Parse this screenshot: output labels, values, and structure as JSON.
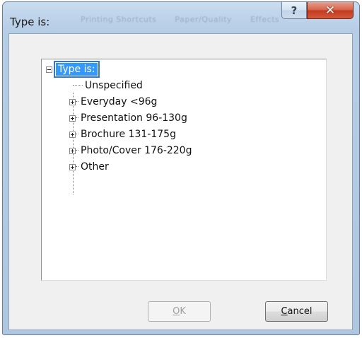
{
  "window": {
    "title": "Type is:",
    "background_tabs": [
      "Printing Shortcuts",
      "Paper/Quality",
      "Effects"
    ],
    "help_glyph": "?",
    "close_glyph": "✕"
  },
  "tree": {
    "root": {
      "label": "Type is:",
      "expanded": true,
      "selected": true
    },
    "items": [
      {
        "label": "Unspecified",
        "expandable": false
      },
      {
        "label": "Everyday <96g",
        "expandable": true
      },
      {
        "label": "Presentation 96-130g",
        "expandable": true
      },
      {
        "label": "Brochure 131-175g",
        "expandable": true
      },
      {
        "label": "Photo/Cover 176-220g",
        "expandable": true
      },
      {
        "label": "Other",
        "expandable": true
      }
    ]
  },
  "buttons": {
    "ok": {
      "label": "OK",
      "enabled": false
    },
    "cancel": {
      "label": "Cancel",
      "enabled": true
    }
  },
  "colors": {
    "selection": "#3399ff",
    "close_button": "#c23a1e",
    "frame": "#b6cde6"
  }
}
